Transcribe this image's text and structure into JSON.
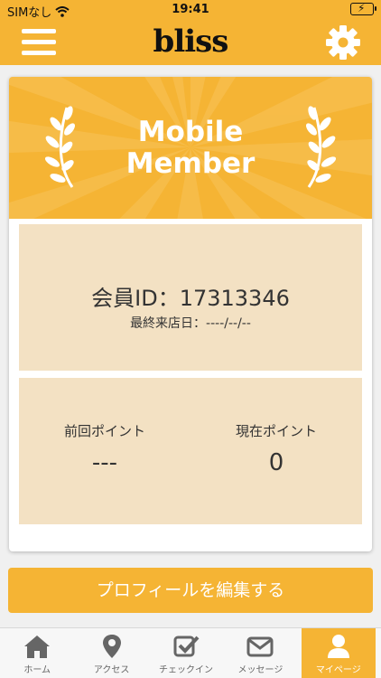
{
  "status_bar": {
    "carrier": "SIMなし",
    "time": "19:41"
  },
  "header": {
    "logo": "bliss",
    "menu_icon": "hamburger-icon",
    "settings_icon": "gear-icon"
  },
  "banner": {
    "title_line1": "Mobile",
    "title_line2": "Member"
  },
  "member": {
    "id_text": "会員ID：17313346",
    "last_visit": "最終来店日：----/--/--"
  },
  "points": {
    "previous_label": "前回ポイント",
    "previous_value": "---",
    "current_label": "現在ポイント",
    "current_value": "0"
  },
  "edit_profile_button": "プロフィールを編集する",
  "tabs": [
    {
      "label": "ホーム",
      "icon": "home-icon",
      "active": false
    },
    {
      "label": "アクセス",
      "icon": "map-pin-icon",
      "active": false
    },
    {
      "label": "チェックイン",
      "icon": "checkin-icon",
      "active": false
    },
    {
      "label": "メッセージ",
      "icon": "mail-icon",
      "active": false
    },
    {
      "label": "マイページ",
      "icon": "user-icon",
      "active": true
    }
  ],
  "colors": {
    "accent": "#f5b434",
    "panel": "#f3e1c3",
    "text": "#333333"
  }
}
